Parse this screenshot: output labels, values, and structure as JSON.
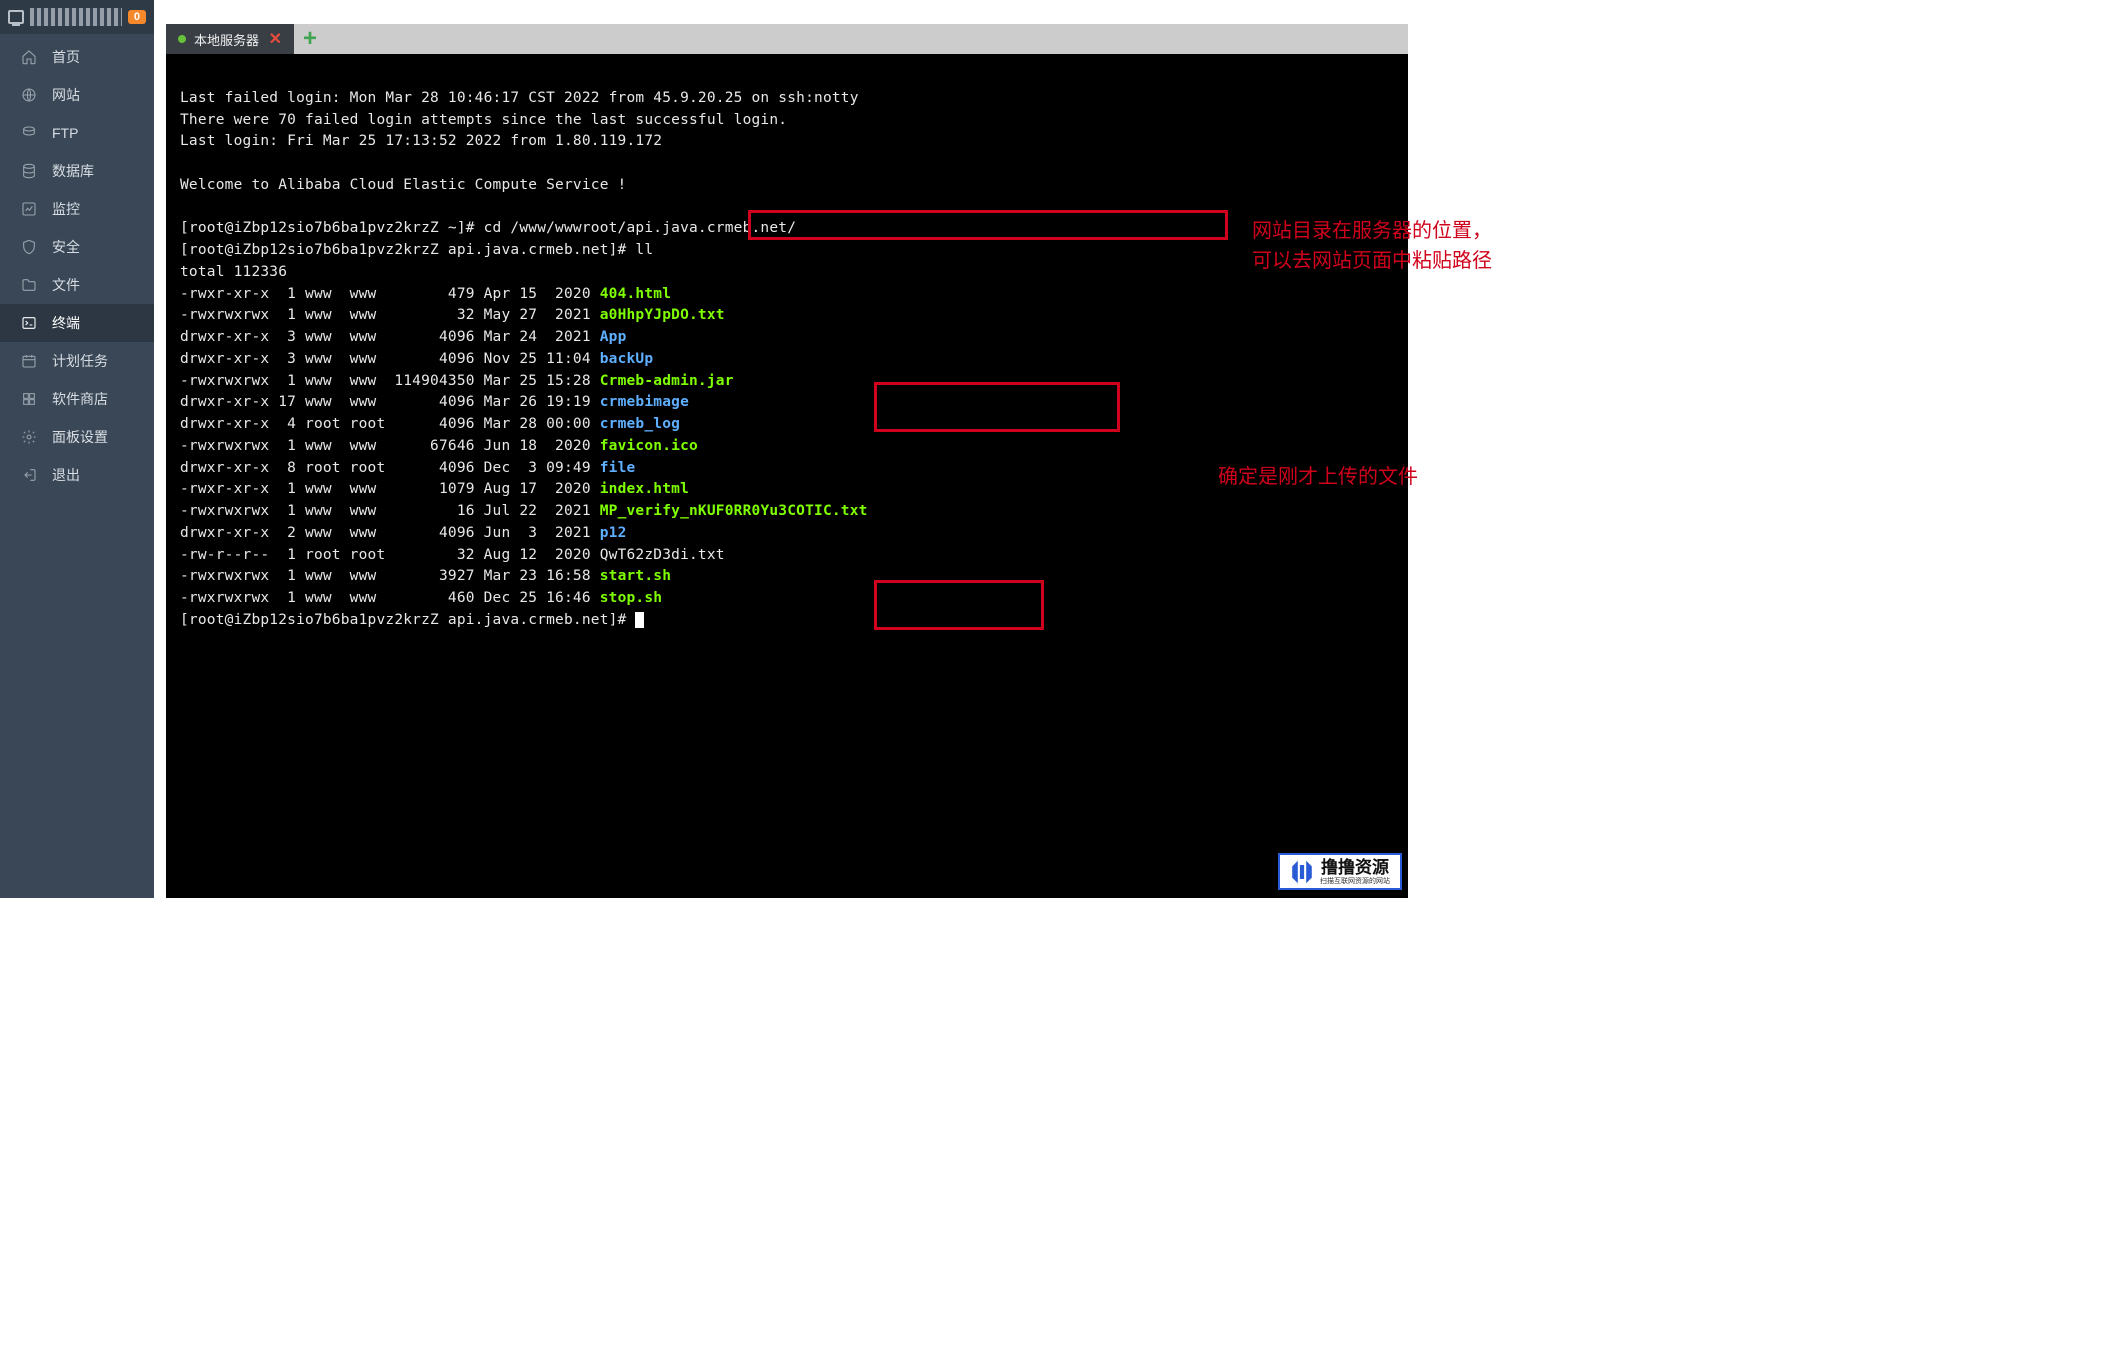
{
  "sidebar": {
    "badge": "0",
    "items": [
      {
        "id": "home",
        "label": "首页"
      },
      {
        "id": "site",
        "label": "网站"
      },
      {
        "id": "ftp",
        "label": "FTP"
      },
      {
        "id": "db",
        "label": "数据库"
      },
      {
        "id": "monitor",
        "label": "监控"
      },
      {
        "id": "security",
        "label": "安全"
      },
      {
        "id": "files",
        "label": "文件"
      },
      {
        "id": "terminal",
        "label": "终端"
      },
      {
        "id": "cron",
        "label": "计划任务"
      },
      {
        "id": "store",
        "label": "软件商店"
      },
      {
        "id": "settings",
        "label": "面板设置"
      },
      {
        "id": "logout",
        "label": "退出"
      }
    ],
    "activeId": "terminal"
  },
  "tabs": {
    "items": [
      {
        "label": "本地服务器",
        "status": "connected"
      }
    ],
    "close_glyph": "✕",
    "add_glyph": "+"
  },
  "terminal": {
    "login_msgs": [
      "Last failed login: Mon Mar 28 10:46:17 CST 2022 from 45.9.20.25 on ssh:notty",
      "There were 70 failed login attempts since the last successful login.",
      "Last login: Fri Mar 25 17:13:52 2022 from 1.80.119.172"
    ],
    "welcome": "Welcome to Alibaba Cloud Elastic Compute Service !",
    "prompt1_user": "root@iZbp12sio7b6ba1pvz2krzZ",
    "prompt1_cwd": "~",
    "cmd1": "cd /www/wwwroot/api.java.crmeb.net/",
    "prompt2_cwd": "api.java.crmeb.net",
    "cmd2": "ll",
    "total": "total 112336",
    "listing": [
      {
        "perm": "-rwxr-xr-x",
        "n": "1",
        "own": "www",
        "grp": "www",
        "size": "479",
        "date": "Apr 15  2020",
        "name": "404.html",
        "cls": "g"
      },
      {
        "perm": "-rwxrwxrwx",
        "n": "1",
        "own": "www",
        "grp": "www",
        "size": "32",
        "date": "May 27  2021",
        "name": "a0HhpYJpDO.txt",
        "cls": "g"
      },
      {
        "perm": "drwxr-xr-x",
        "n": "3",
        "own": "www",
        "grp": "www",
        "size": "4096",
        "date": "Mar 24  2021",
        "name": "App",
        "cls": "b"
      },
      {
        "perm": "drwxr-xr-x",
        "n": "3",
        "own": "www",
        "grp": "www",
        "size": "4096",
        "date": "Nov 25 11:04",
        "name": "backUp",
        "cls": "b"
      },
      {
        "perm": "-rwxrwxrwx",
        "n": "1",
        "own": "www",
        "grp": "www",
        "size": "114904350",
        "date": "Mar 25 15:28",
        "name": "Crmeb-admin.jar",
        "cls": "g"
      },
      {
        "perm": "drwxr-xr-x",
        "n": "17",
        "own": "www",
        "grp": "www",
        "size": "4096",
        "date": "Mar 26 19:19",
        "name": "crmebimage",
        "cls": "b"
      },
      {
        "perm": "drwxr-xr-x",
        "n": "4",
        "own": "root",
        "grp": "root",
        "size": "4096",
        "date": "Mar 28 00:00",
        "name": "crmeb_log",
        "cls": "b"
      },
      {
        "perm": "-rwxrwxrwx",
        "n": "1",
        "own": "www",
        "grp": "www",
        "size": "67646",
        "date": "Jun 18  2020",
        "name": "favicon.ico",
        "cls": "g"
      },
      {
        "perm": "drwxr-xr-x",
        "n": "8",
        "own": "root",
        "grp": "root",
        "size": "4096",
        "date": "Dec  3 09:49",
        "name": "file",
        "cls": "b"
      },
      {
        "perm": "-rwxr-xr-x",
        "n": "1",
        "own": "www",
        "grp": "www",
        "size": "1079",
        "date": "Aug 17  2020",
        "name": "index.html",
        "cls": "g"
      },
      {
        "perm": "-rwxrwxrwx",
        "n": "1",
        "own": "www",
        "grp": "www",
        "size": "16",
        "date": "Jul 22  2021",
        "name": "MP_verify_nKUF0RR0Yu3COTIC.txt",
        "cls": "g"
      },
      {
        "perm": "drwxr-xr-x",
        "n": "2",
        "own": "www",
        "grp": "www",
        "size": "4096",
        "date": "Jun  3  2021",
        "name": "p12",
        "cls": "b"
      },
      {
        "perm": "-rw-r--r--",
        "n": "1",
        "own": "root",
        "grp": "root",
        "size": "32",
        "date": "Aug 12  2020",
        "name": "QwT62zD3di.txt",
        "cls": ""
      },
      {
        "perm": "-rwxrwxrwx",
        "n": "1",
        "own": "www",
        "grp": "www",
        "size": "3927",
        "date": "Mar 23 16:58",
        "name": "start.sh",
        "cls": "g"
      },
      {
        "perm": "-rwxrwxrwx",
        "n": "1",
        "own": "www",
        "grp": "www",
        "size": "460",
        "date": "Dec 25 16:46",
        "name": "stop.sh",
        "cls": "g"
      }
    ]
  },
  "annotations": {
    "note1": "网站目录在服务器的位置，\n可以去网站页面中粘贴路径",
    "note2": "确定是刚才上传的文件"
  },
  "watermark": {
    "primary": "撸撸资源",
    "secondary": "扫描互联网资源的网站"
  }
}
